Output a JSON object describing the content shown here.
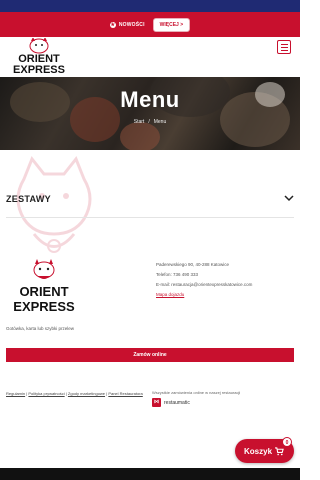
{
  "banner": {
    "news_label": "NOWOŚCI",
    "button_label": "WIĘCEJ >"
  },
  "header": {
    "logo_text_line1": "ORIENT",
    "logo_text_line2": "EXPRESS"
  },
  "hero": {
    "title": "Menu",
    "breadcrumb_home": "Start",
    "breadcrumb_sep": "/",
    "breadcrumb_current": "Menu"
  },
  "section": {
    "title": "ZESTAWY"
  },
  "footer": {
    "logo_line1": "ORIENT",
    "logo_line2": "EXPRESS",
    "address": "Paderewskiego 90, 40-288 Katowice",
    "phone": "Telefon: 736 490 333",
    "email": "E-mail: restauracja@orientexpresskatowice.com",
    "directions_link": "Mapa dojazdu",
    "payment": "Gotówka, karta lub szybki przelew",
    "order_button": "Zamów online",
    "links": [
      "Regulamin",
      "Polityka prywatności",
      "Zgody marketingowe",
      "Panel Restauratora"
    ],
    "promo_text": "Wszystkie zamówienia online w naszej restauracji",
    "platform_name": "restaumatic"
  },
  "cart": {
    "label": "Koszyk",
    "count": "0"
  },
  "colors": {
    "brand": "#c8102e",
    "navy": "#1f2a73"
  }
}
